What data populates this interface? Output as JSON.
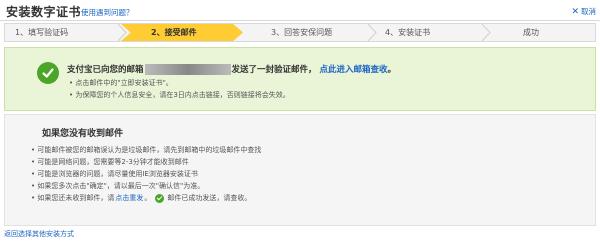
{
  "header": {
    "title": "安装数字证书",
    "help_link": "使用遇到问题？",
    "cancel_label": "取消"
  },
  "steps": [
    {
      "label": "1、填写验证码"
    },
    {
      "label": "2、接受邮件"
    },
    {
      "label": "3、回答安保问题"
    },
    {
      "label": "4、安装证书"
    },
    {
      "label": "成功"
    }
  ],
  "success": {
    "msg_prefix": "支付宝已向您的邮箱",
    "msg_suffix": "发送了一封验证邮件，",
    "enter_link": "点此进入邮箱查收",
    "msg_end": "。",
    "tip1": "• 点击邮件中的\"立即安装证书\"。",
    "tip2": "• 为保障您的个人信息安全，请在3日内点击链接，否则链接将会失效。"
  },
  "not_received": {
    "title": "如果您没有收到邮件",
    "items": [
      "• 可能邮件被您的邮箱误认为是垃圾邮件，请先到邮箱中的垃圾邮件中查找",
      "• 可能是网络问题，您需要等2-3分钟才能收到邮件",
      "• 可能是浏览器的问题，请尽量使用IE浏览器安装证书",
      "• 如果您多次点击\"确定\"，请以最后一次\"确认信\"为准。"
    ],
    "last_prefix": "• 如果您还未收到邮件，请",
    "resend_link": "点击重发",
    "last_mid": "。",
    "sent_text": "邮件已成功发送，请查收。"
  },
  "footer": {
    "link": "返回选择其他安装方式"
  },
  "colors": {
    "accent": "#ffcc33",
    "success_bg": "#eaf5d8",
    "link": "#1a64c3",
    "check": "#4ca528"
  }
}
